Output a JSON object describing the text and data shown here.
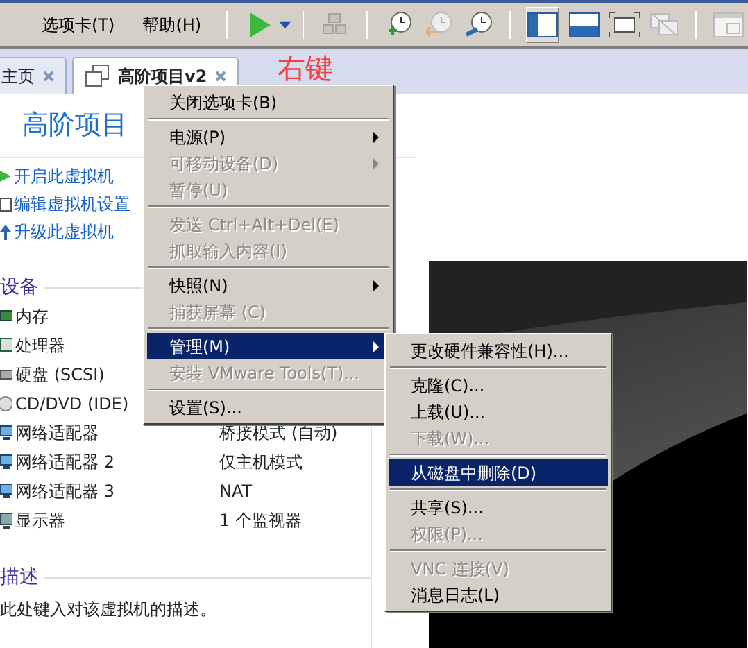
{
  "menubar": [
    {
      "label": "选项卡(T)"
    },
    {
      "label": "帮助(H)"
    }
  ],
  "tabs": [
    {
      "label": "主页",
      "selected": false
    },
    {
      "label": "高阶项目v2",
      "selected": true
    }
  ],
  "annotation": "右键",
  "vm_title": "高阶项目",
  "actions": [
    {
      "label": "开启此虚拟机",
      "kind": "play"
    },
    {
      "label": "编辑虚拟机设置",
      "kind": "settings"
    },
    {
      "label": "升级此虚拟机",
      "kind": "upgrade"
    }
  ],
  "devices_heading": "设备",
  "devices": [
    {
      "name": "内存",
      "kind": "memory"
    },
    {
      "name": "处理器",
      "kind": "cpu"
    },
    {
      "name": "硬盘 (SCSI)",
      "kind": "disk"
    },
    {
      "name": "CD/DVD (IDE)",
      "kind": "cd"
    },
    {
      "name": "网络适配器",
      "kind": "network",
      "value": "桥接模式 (自动)"
    },
    {
      "name": "网络适配器 2",
      "kind": "network",
      "value": "仅主机模式"
    },
    {
      "name": "网络适配器 3",
      "kind": "network",
      "value": "NAT"
    },
    {
      "name": "显示器",
      "kind": "monitor",
      "value": "1 个监视器"
    }
  ],
  "description_heading": "描述",
  "description_text": "此处键入对该虚拟机的描述。",
  "context_menu": [
    {
      "kind": "item",
      "label": "关闭选项卡(B)",
      "disabled": false,
      "submenu": false,
      "selected": false
    },
    {
      "kind": "separator"
    },
    {
      "kind": "item",
      "label": "电源(P)",
      "disabled": false,
      "submenu": true,
      "selected": false
    },
    {
      "kind": "item",
      "label": "可移动设备(D)",
      "disabled": true,
      "submenu": true,
      "selected": false
    },
    {
      "kind": "item",
      "label": "暂停(U)",
      "disabled": true,
      "submenu": false,
      "selected": false
    },
    {
      "kind": "separator"
    },
    {
      "kind": "item",
      "label": "发送 Ctrl+Alt+Del(E)",
      "disabled": true,
      "submenu": false,
      "selected": false
    },
    {
      "kind": "item",
      "label": "抓取输入内容(I)",
      "disabled": true,
      "submenu": false,
      "selected": false
    },
    {
      "kind": "separator"
    },
    {
      "kind": "item",
      "label": "快照(N)",
      "disabled": false,
      "submenu": true,
      "selected": false
    },
    {
      "kind": "item",
      "label": "捕获屏幕 (C)",
      "disabled": true,
      "submenu": false,
      "selected": false
    },
    {
      "kind": "separator"
    },
    {
      "kind": "item",
      "label": "管理(M)",
      "disabled": false,
      "submenu": true,
      "selected": true
    },
    {
      "kind": "item",
      "label": "安装 VMware Tools(T)...",
      "disabled": true,
      "submenu": false,
      "selected": false
    },
    {
      "kind": "separator"
    },
    {
      "kind": "item",
      "label": "设置(S)...",
      "disabled": false,
      "submenu": false,
      "selected": false
    }
  ],
  "submenu": [
    {
      "kind": "item",
      "label": "更改硬件兼容性(H)...",
      "disabled": false,
      "selected": false
    },
    {
      "kind": "separator"
    },
    {
      "kind": "item",
      "label": "克隆(C)...",
      "disabled": false,
      "selected": false
    },
    {
      "kind": "item",
      "label": "上载(U)...",
      "disabled": false,
      "selected": false
    },
    {
      "kind": "item",
      "label": "下载(W)...",
      "disabled": true,
      "selected": false
    },
    {
      "kind": "separator"
    },
    {
      "kind": "item",
      "label": "从磁盘中删除(D)",
      "disabled": false,
      "selected": true
    },
    {
      "kind": "separator"
    },
    {
      "kind": "item",
      "label": "共享(S)...",
      "disabled": false,
      "selected": false
    },
    {
      "kind": "item",
      "label": "权限(P)...",
      "disabled": true,
      "selected": false
    },
    {
      "kind": "separator"
    },
    {
      "kind": "item",
      "label": "VNC 连接(V)",
      "disabled": true,
      "selected": false
    },
    {
      "kind": "item",
      "label": "消息日志(L)",
      "disabled": false,
      "selected": false
    }
  ]
}
